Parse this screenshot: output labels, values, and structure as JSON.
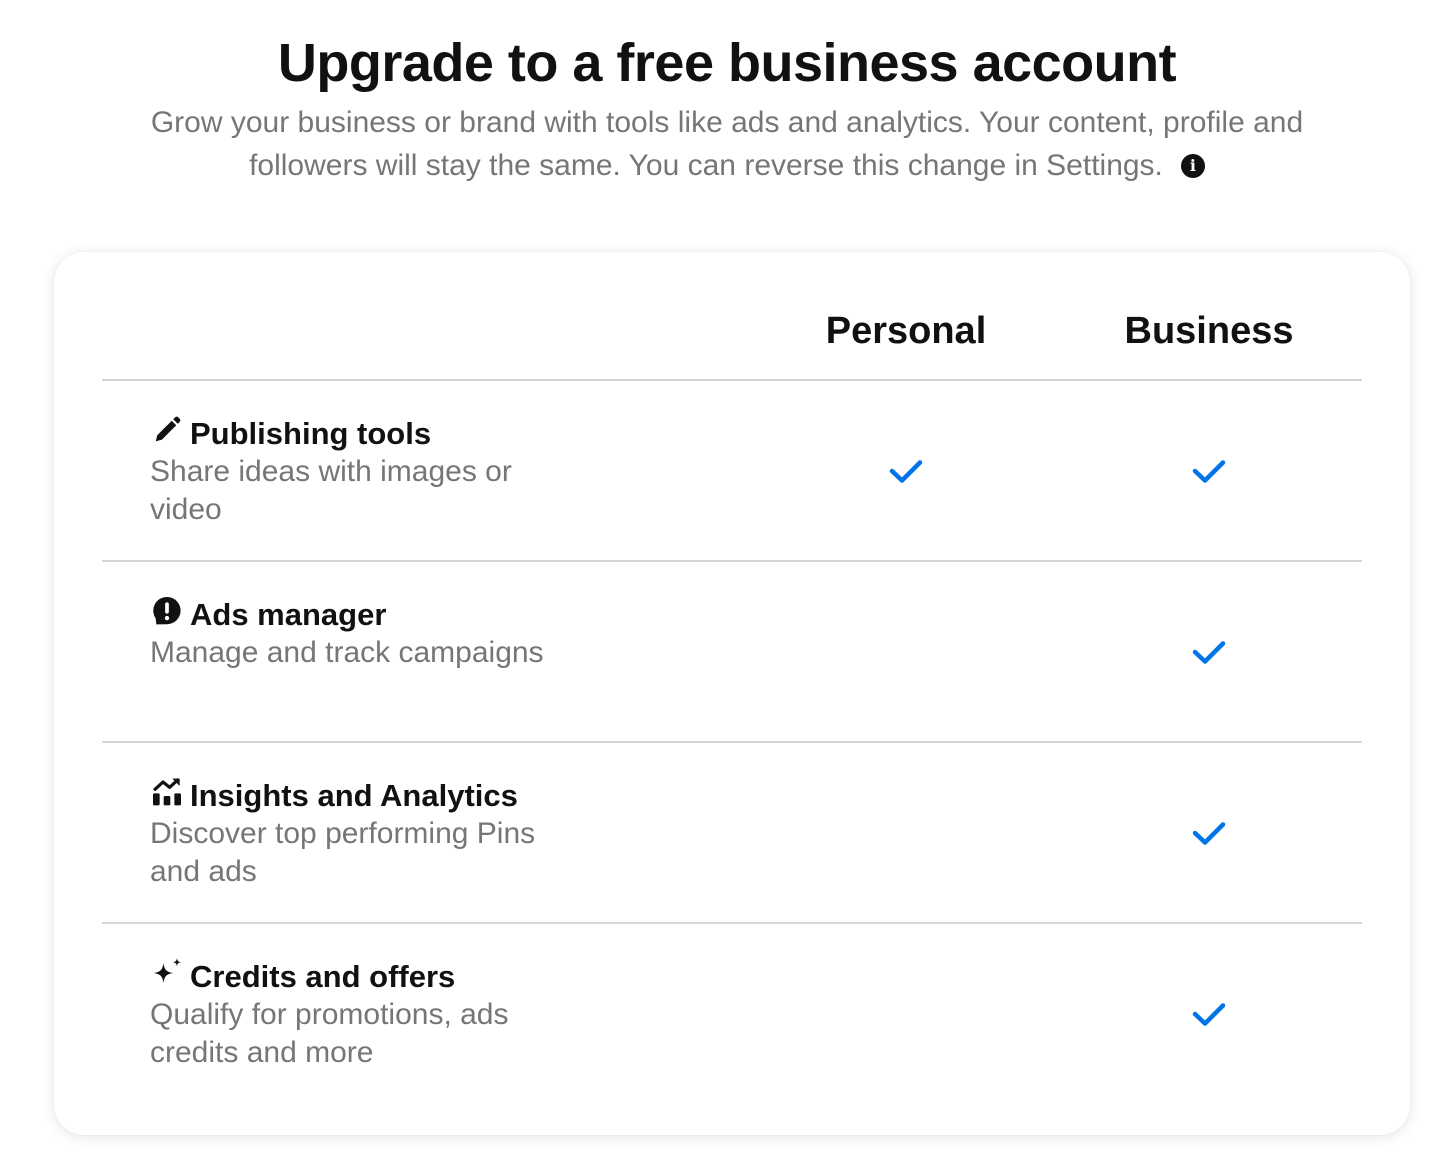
{
  "header": {
    "title": "Upgrade to a free business account",
    "subtitle": "Grow your business or brand with tools like ads and analytics. Your content, profile and followers will stay the same. You can reverse this change in Settings.",
    "info_icon": "i"
  },
  "comparison": {
    "columns": [
      "Personal",
      "Business"
    ],
    "rows": [
      {
        "icon": "pencil-icon",
        "title": "Publishing tools",
        "description": "Share ideas with images or video",
        "personal": true,
        "business": true
      },
      {
        "icon": "ads-alert-icon",
        "title": "Ads manager",
        "description": "Manage and track campaigns",
        "personal": false,
        "business": true
      },
      {
        "icon": "analytics-chart-icon",
        "title": "Insights and Analytics",
        "description": "Discover top performing Pins and ads",
        "personal": false,
        "business": true
      },
      {
        "icon": "sparkle-icon",
        "title": "Credits and offers",
        "description": "Qualify for promotions, ads credits and more",
        "personal": false,
        "business": true
      }
    ]
  },
  "colors": {
    "check": "#0074e8",
    "muted_text": "#767676",
    "divider": "#d6d6d6"
  }
}
